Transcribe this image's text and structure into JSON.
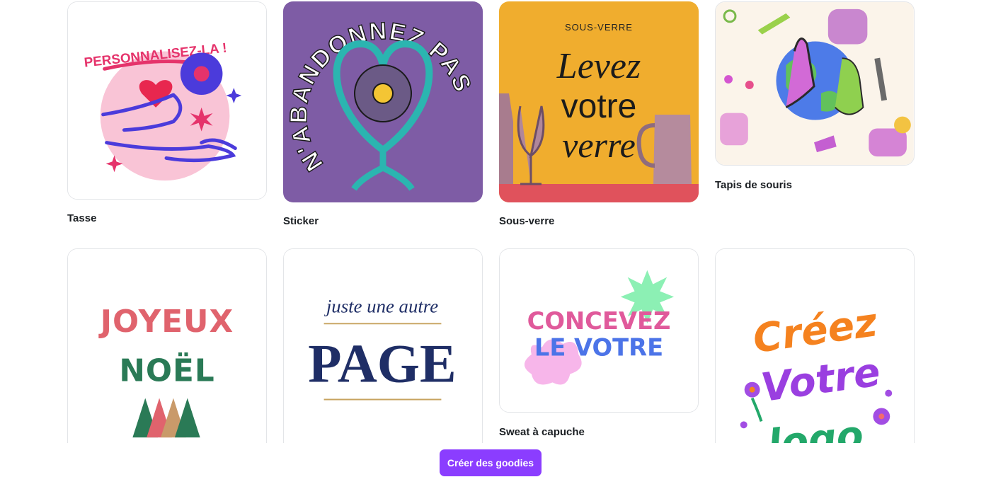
{
  "products": [
    {
      "label": "Tasse",
      "art_text": "PERSONNALISEZ-LA !"
    },
    {
      "label": "Sticker",
      "art_text": "N'ABANDONNEZ PAS"
    },
    {
      "label": "Sous-verre",
      "art_kicker": "SOUS-VERRE",
      "art_line1": "Levez",
      "art_line2": "votre",
      "art_line3": "verre"
    },
    {
      "label": "Tapis de souris"
    },
    {
      "label": "",
      "art_line1": "JOYEUX",
      "art_line2": "NOËL"
    },
    {
      "label": "",
      "art_line1": "juste une autre",
      "art_line2": "PAGE"
    },
    {
      "label": "Sweat à capuche",
      "art_line1": "CONCEVEZ",
      "art_line2": "LE VOTRE"
    },
    {
      "label": "",
      "art_line1": "Créez",
      "art_line2": "Votre",
      "art_line3": "logo"
    }
  ],
  "cta": {
    "label": "Créer des goodies"
  },
  "colors": {
    "accent": "#8b3dff",
    "card_border": "#e3e5e8",
    "label": "#1b1f23"
  }
}
